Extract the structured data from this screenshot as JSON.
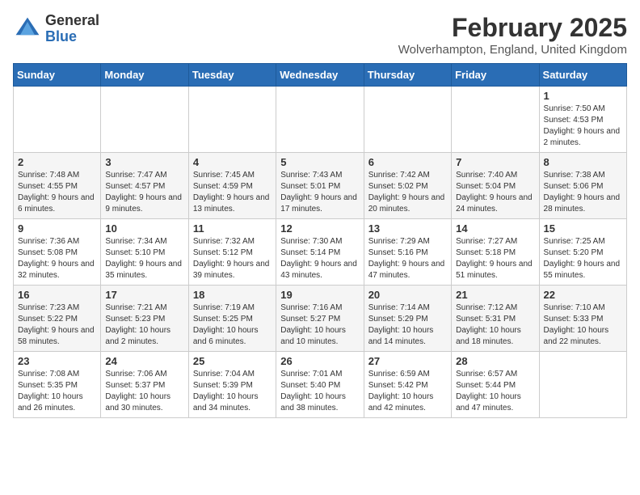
{
  "header": {
    "logo_general": "General",
    "logo_blue": "Blue",
    "month_title": "February 2025",
    "subtitle": "Wolverhampton, England, United Kingdom"
  },
  "days_of_week": [
    "Sunday",
    "Monday",
    "Tuesday",
    "Wednesday",
    "Thursday",
    "Friday",
    "Saturday"
  ],
  "weeks": [
    [
      {
        "day": "",
        "info": ""
      },
      {
        "day": "",
        "info": ""
      },
      {
        "day": "",
        "info": ""
      },
      {
        "day": "",
        "info": ""
      },
      {
        "day": "",
        "info": ""
      },
      {
        "day": "",
        "info": ""
      },
      {
        "day": "1",
        "info": "Sunrise: 7:50 AM\nSunset: 4:53 PM\nDaylight: 9 hours and 2 minutes."
      }
    ],
    [
      {
        "day": "2",
        "info": "Sunrise: 7:48 AM\nSunset: 4:55 PM\nDaylight: 9 hours and 6 minutes."
      },
      {
        "day": "3",
        "info": "Sunrise: 7:47 AM\nSunset: 4:57 PM\nDaylight: 9 hours and 9 minutes."
      },
      {
        "day": "4",
        "info": "Sunrise: 7:45 AM\nSunset: 4:59 PM\nDaylight: 9 hours and 13 minutes."
      },
      {
        "day": "5",
        "info": "Sunrise: 7:43 AM\nSunset: 5:01 PM\nDaylight: 9 hours and 17 minutes."
      },
      {
        "day": "6",
        "info": "Sunrise: 7:42 AM\nSunset: 5:02 PM\nDaylight: 9 hours and 20 minutes."
      },
      {
        "day": "7",
        "info": "Sunrise: 7:40 AM\nSunset: 5:04 PM\nDaylight: 9 hours and 24 minutes."
      },
      {
        "day": "8",
        "info": "Sunrise: 7:38 AM\nSunset: 5:06 PM\nDaylight: 9 hours and 28 minutes."
      }
    ],
    [
      {
        "day": "9",
        "info": "Sunrise: 7:36 AM\nSunset: 5:08 PM\nDaylight: 9 hours and 32 minutes."
      },
      {
        "day": "10",
        "info": "Sunrise: 7:34 AM\nSunset: 5:10 PM\nDaylight: 9 hours and 35 minutes."
      },
      {
        "day": "11",
        "info": "Sunrise: 7:32 AM\nSunset: 5:12 PM\nDaylight: 9 hours and 39 minutes."
      },
      {
        "day": "12",
        "info": "Sunrise: 7:30 AM\nSunset: 5:14 PM\nDaylight: 9 hours and 43 minutes."
      },
      {
        "day": "13",
        "info": "Sunrise: 7:29 AM\nSunset: 5:16 PM\nDaylight: 9 hours and 47 minutes."
      },
      {
        "day": "14",
        "info": "Sunrise: 7:27 AM\nSunset: 5:18 PM\nDaylight: 9 hours and 51 minutes."
      },
      {
        "day": "15",
        "info": "Sunrise: 7:25 AM\nSunset: 5:20 PM\nDaylight: 9 hours and 55 minutes."
      }
    ],
    [
      {
        "day": "16",
        "info": "Sunrise: 7:23 AM\nSunset: 5:22 PM\nDaylight: 9 hours and 58 minutes."
      },
      {
        "day": "17",
        "info": "Sunrise: 7:21 AM\nSunset: 5:23 PM\nDaylight: 10 hours and 2 minutes."
      },
      {
        "day": "18",
        "info": "Sunrise: 7:19 AM\nSunset: 5:25 PM\nDaylight: 10 hours and 6 minutes."
      },
      {
        "day": "19",
        "info": "Sunrise: 7:16 AM\nSunset: 5:27 PM\nDaylight: 10 hours and 10 minutes."
      },
      {
        "day": "20",
        "info": "Sunrise: 7:14 AM\nSunset: 5:29 PM\nDaylight: 10 hours and 14 minutes."
      },
      {
        "day": "21",
        "info": "Sunrise: 7:12 AM\nSunset: 5:31 PM\nDaylight: 10 hours and 18 minutes."
      },
      {
        "day": "22",
        "info": "Sunrise: 7:10 AM\nSunset: 5:33 PM\nDaylight: 10 hours and 22 minutes."
      }
    ],
    [
      {
        "day": "23",
        "info": "Sunrise: 7:08 AM\nSunset: 5:35 PM\nDaylight: 10 hours and 26 minutes."
      },
      {
        "day": "24",
        "info": "Sunrise: 7:06 AM\nSunset: 5:37 PM\nDaylight: 10 hours and 30 minutes."
      },
      {
        "day": "25",
        "info": "Sunrise: 7:04 AM\nSunset: 5:39 PM\nDaylight: 10 hours and 34 minutes."
      },
      {
        "day": "26",
        "info": "Sunrise: 7:01 AM\nSunset: 5:40 PM\nDaylight: 10 hours and 38 minutes."
      },
      {
        "day": "27",
        "info": "Sunrise: 6:59 AM\nSunset: 5:42 PM\nDaylight: 10 hours and 42 minutes."
      },
      {
        "day": "28",
        "info": "Sunrise: 6:57 AM\nSunset: 5:44 PM\nDaylight: 10 hours and 47 minutes."
      },
      {
        "day": "",
        "info": ""
      }
    ]
  ]
}
